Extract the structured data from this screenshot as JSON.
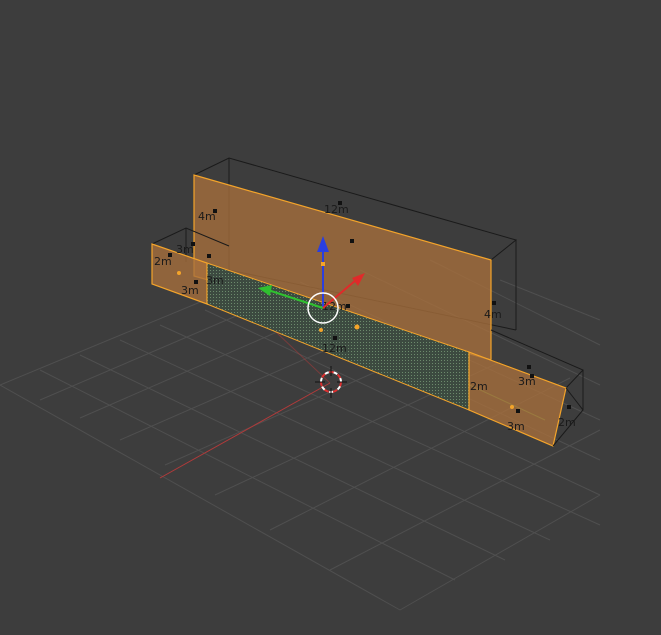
{
  "colors": {
    "background": "#3d3d3d",
    "grid": "#4f4f4f",
    "x_axis": "#b33a3a",
    "y_axis": "#6aa04a",
    "selected_outline": "#f4a42a",
    "selected_face": "#a8703c",
    "dimension_text": "#1a1a1a",
    "manipulator_x": "#e02a2a",
    "manipulator_y": "#2fc12f",
    "manipulator_z": "#2a3fe0"
  },
  "dimensions": {
    "top_length": "12m",
    "tall_height": "4m",
    "tall_height_right": "4m",
    "left_block_width": "3m",
    "left_block_height": "2m",
    "left_block_depth": "3m",
    "left_inner": "3m",
    "center_length": "12m",
    "bottom_length": "12m",
    "right_block_height": "2m",
    "right_block_width": "3m",
    "right_block_depth": "3m",
    "right_block_outer": "2m"
  },
  "icons": {
    "cursor": "3d-cursor-icon",
    "manipulator": "transform-manipulator-icon"
  }
}
